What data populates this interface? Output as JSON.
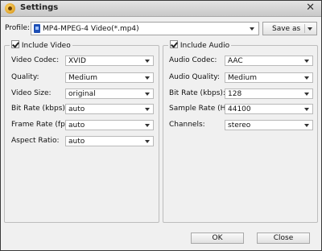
{
  "window": {
    "title": "Settings"
  },
  "profile": {
    "label": "Profile:",
    "value": "MP4-MPEG-4 Video(*.mp4)",
    "save_as": "Save as"
  },
  "video": {
    "include_label": "Include Video",
    "fields": [
      {
        "label": "Video Codec:",
        "value": "XVID"
      },
      {
        "label": "Quality:",
        "value": "Medium"
      },
      {
        "label": "Video Size:",
        "value": "original"
      },
      {
        "label": "Bit Rate (kbps):",
        "value": "auto"
      },
      {
        "label": "Frame Rate (fps):",
        "value": "auto"
      },
      {
        "label": "Aspect Ratio:",
        "value": "auto"
      }
    ]
  },
  "audio": {
    "include_label": "Include Audio",
    "fields": [
      {
        "label": "Audio Codec:",
        "value": "AAC"
      },
      {
        "label": "Audio Quality:",
        "value": "Medium"
      },
      {
        "label": "Bit Rate (kbps):",
        "value": "128"
      },
      {
        "label": "Sample Rate (Hz):",
        "value": "44100"
      },
      {
        "label": "Channels:",
        "value": "stereo"
      }
    ]
  },
  "buttons": {
    "ok": "OK",
    "close": "Close"
  }
}
